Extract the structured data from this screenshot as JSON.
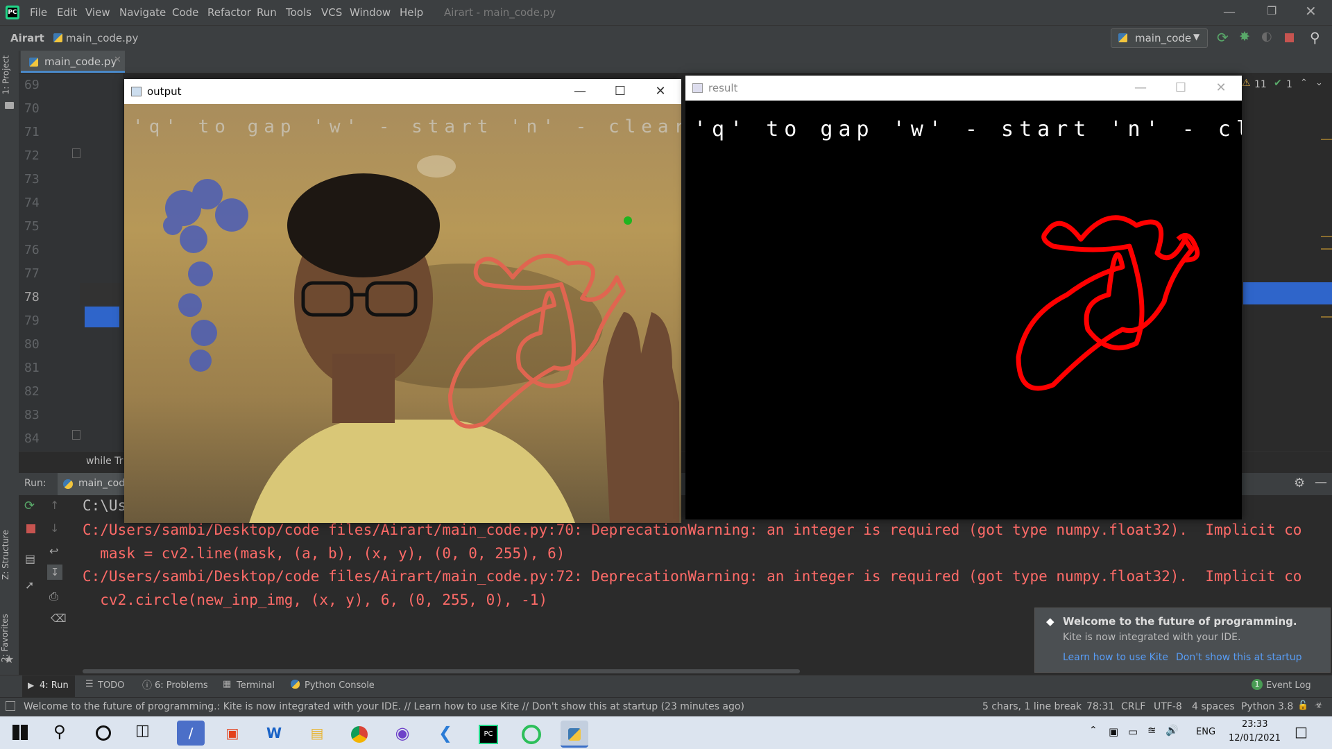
{
  "titlebar": {
    "menu": [
      "File",
      "Edit",
      "View",
      "Navigate",
      "Code",
      "Refactor",
      "Run",
      "Tools",
      "VCS",
      "Window",
      "Help"
    ],
    "window_title": "Airart - main_code.py"
  },
  "navbar": {
    "project": "Airart",
    "file": "main_code.py",
    "run_config": "main_code"
  },
  "editor": {
    "tab_label": "main_code.py",
    "line_numbers": [
      "69",
      "70",
      "71",
      "72",
      "73",
      "74",
      "75",
      "76",
      "77",
      "78",
      "79",
      "80",
      "81",
      "82",
      "83",
      "84"
    ],
    "current_line": "78",
    "breadcrumb": "while Tr",
    "inspection_warnings": "11",
    "inspection_ok": "1"
  },
  "side_strip": {
    "project": "1: Project",
    "structure": "Z: Structure",
    "favorites": "2: Favorites"
  },
  "run_panel": {
    "label": "Run:",
    "tab": "main_code",
    "lines": [
      "C:\\Us",
      "C:/Users/sambi/Desktop/code files/Airart/main_code.py:70: DeprecationWarning: an integer is required (got type numpy.float32).  Implicit co",
      "  mask = cv2.line(mask, (a, b), (x, y), (0, 0, 255), 6)",
      "C:/Users/sambi/Desktop/code files/Airart/main_code.py:72: DeprecationWarning: an integer is required (got type numpy.float32).  Implicit co",
      "  cv2.circle(new_inp_img, (x, y), 6, (0, 255, 0), -1)"
    ]
  },
  "output_window": {
    "title": "output",
    "overlay": "'q' to gap 'w' - start 'n' - clear"
  },
  "result_window": {
    "title": "result",
    "overlay": "'q' to gap 'w' - start 'n' - clear"
  },
  "kite_popup": {
    "title": "Welcome to the future of programming.",
    "body": "Kite is now integrated with your IDE.",
    "link1": "Learn how to use Kite",
    "link2": "Don't show this at startup"
  },
  "toolwindows": {
    "run": "4: Run",
    "todo": "TODO",
    "problems": "6: Problems",
    "terminal": "Terminal",
    "python_console": "Python Console",
    "event_log": "Event Log",
    "event_count": "1"
  },
  "statusbar": {
    "message": "Welcome to the future of programming.: Kite is now integrated with your IDE. // Learn how to use Kite // Don't show this at startup (23 minutes ago)",
    "chars": "5 chars, 1 line break",
    "position": "78:31",
    "line_sep": "CRLF",
    "encoding": "UTF-8",
    "indent": "4 spaces",
    "interpreter": "Python 3.8"
  },
  "taskbar": {
    "lang": "ENG",
    "time": "23:33",
    "date": "12/01/2021"
  },
  "colors": {
    "ide_bg": "#2b2b2b",
    "panel": "#3c3f41",
    "error_text": "#ff6b68",
    "drawing_red": "#ff0000",
    "accent_blue": "#2f65ca"
  }
}
